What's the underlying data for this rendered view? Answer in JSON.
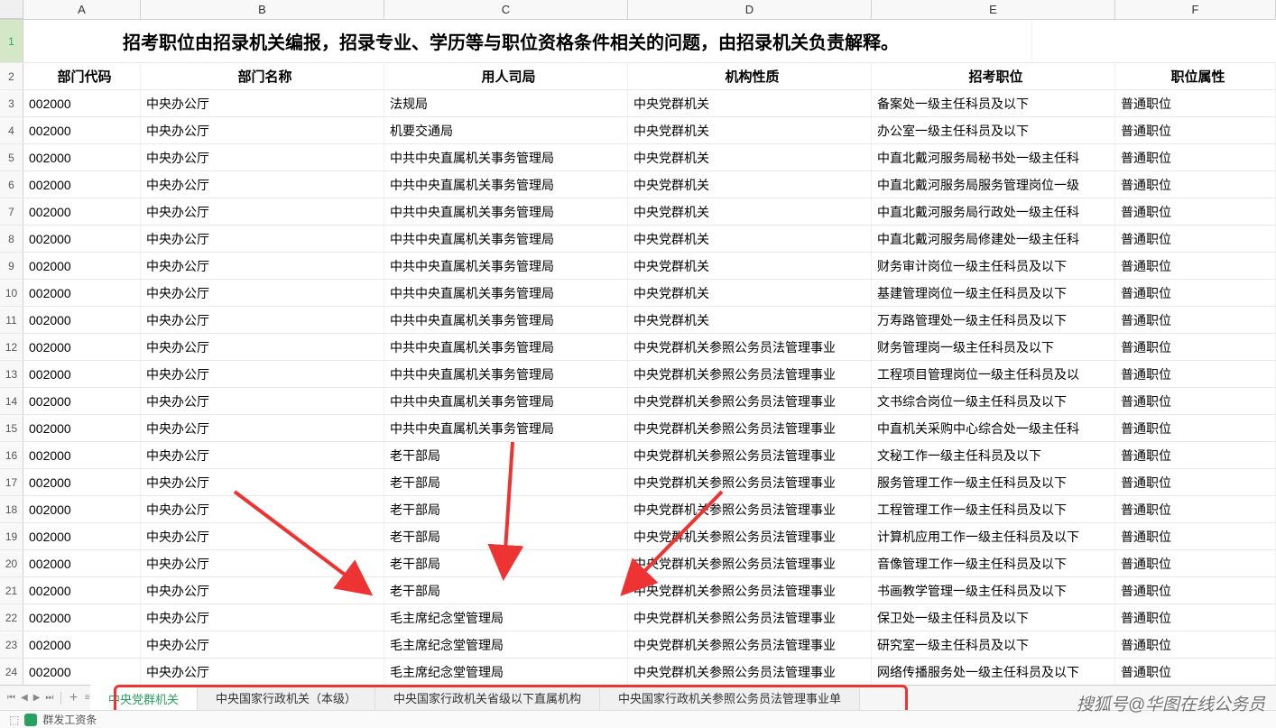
{
  "columns": [
    "A",
    "B",
    "C",
    "D",
    "E",
    "F"
  ],
  "title": "招考职位由招录机关编报，招录专业、学历等与职位资格条件相关的问题，由招录机关负责解释。",
  "headers": {
    "A": "部门代码",
    "B": "部门名称",
    "C": "用人司局",
    "D": "机构性质",
    "E": "招考职位",
    "F": "职位属性"
  },
  "rows": [
    {
      "n": 3,
      "A": "002000",
      "B": "中央办公厅",
      "C": "法规局",
      "D": "中央党群机关",
      "E": "备案处一级主任科员及以下",
      "F": "普通职位"
    },
    {
      "n": 4,
      "A": "002000",
      "B": "中央办公厅",
      "C": "机要交通局",
      "D": "中央党群机关",
      "E": "办公室一级主任科员及以下",
      "F": "普通职位"
    },
    {
      "n": 5,
      "A": "002000",
      "B": "中央办公厅",
      "C": "中共中央直属机关事务管理局",
      "D": "中央党群机关",
      "E": "中直北戴河服务局秘书处一级主任科",
      "F": "普通职位"
    },
    {
      "n": 6,
      "A": "002000",
      "B": "中央办公厅",
      "C": "中共中央直属机关事务管理局",
      "D": "中央党群机关",
      "E": "中直北戴河服务局服务管理岗位一级",
      "F": "普通职位"
    },
    {
      "n": 7,
      "A": "002000",
      "B": "中央办公厅",
      "C": "中共中央直属机关事务管理局",
      "D": "中央党群机关",
      "E": "中直北戴河服务局行政处一级主任科",
      "F": "普通职位"
    },
    {
      "n": 8,
      "A": "002000",
      "B": "中央办公厅",
      "C": "中共中央直属机关事务管理局",
      "D": "中央党群机关",
      "E": "中直北戴河服务局修建处一级主任科",
      "F": "普通职位"
    },
    {
      "n": 9,
      "A": "002000",
      "B": "中央办公厅",
      "C": "中共中央直属机关事务管理局",
      "D": "中央党群机关",
      "E": "财务审计岗位一级主任科员及以下",
      "F": "普通职位"
    },
    {
      "n": 10,
      "A": "002000",
      "B": "中央办公厅",
      "C": "中共中央直属机关事务管理局",
      "D": "中央党群机关",
      "E": "基建管理岗位一级主任科员及以下",
      "F": "普通职位"
    },
    {
      "n": 11,
      "A": "002000",
      "B": "中央办公厅",
      "C": "中共中央直属机关事务管理局",
      "D": "中央党群机关",
      "E": "万寿路管理处一级主任科员及以下",
      "F": "普通职位"
    },
    {
      "n": 12,
      "A": "002000",
      "B": "中央办公厅",
      "C": "中共中央直属机关事务管理局",
      "D": "中央党群机关参照公务员法管理事业",
      "E": "财务管理岗一级主任科员及以下",
      "F": "普通职位"
    },
    {
      "n": 13,
      "A": "002000",
      "B": "中央办公厅",
      "C": "中共中央直属机关事务管理局",
      "D": "中央党群机关参照公务员法管理事业",
      "E": "工程项目管理岗位一级主任科员及以",
      "F": "普通职位"
    },
    {
      "n": 14,
      "A": "002000",
      "B": "中央办公厅",
      "C": "中共中央直属机关事务管理局",
      "D": "中央党群机关参照公务员法管理事业",
      "E": "文书综合岗位一级主任科员及以下",
      "F": "普通职位"
    },
    {
      "n": 15,
      "A": "002000",
      "B": "中央办公厅",
      "C": "中共中央直属机关事务管理局",
      "D": "中央党群机关参照公务员法管理事业",
      "E": "中直机关采购中心综合处一级主任科",
      "F": "普通职位"
    },
    {
      "n": 16,
      "A": "002000",
      "B": "中央办公厅",
      "C": "老干部局",
      "D": "中央党群机关参照公务员法管理事业",
      "E": "文秘工作一级主任科员及以下",
      "F": "普通职位"
    },
    {
      "n": 17,
      "A": "002000",
      "B": "中央办公厅",
      "C": "老干部局",
      "D": "中央党群机关参照公务员法管理事业",
      "E": "服务管理工作一级主任科员及以下",
      "F": "普通职位"
    },
    {
      "n": 18,
      "A": "002000",
      "B": "中央办公厅",
      "C": "老干部局",
      "D": "中央党群机关参照公务员法管理事业",
      "E": "工程管理工作一级主任科员及以下",
      "F": "普通职位"
    },
    {
      "n": 19,
      "A": "002000",
      "B": "中央办公厅",
      "C": "老干部局",
      "D": "中央党群机关参照公务员法管理事业",
      "E": "计算机应用工作一级主任科员及以下",
      "F": "普通职位"
    },
    {
      "n": 20,
      "A": "002000",
      "B": "中央办公厅",
      "C": "老干部局",
      "D": "中央党群机关参照公务员法管理事业",
      "E": "音像管理工作一级主任科员及以下",
      "F": "普通职位"
    },
    {
      "n": 21,
      "A": "002000",
      "B": "中央办公厅",
      "C": "老干部局",
      "D": "中央党群机关参照公务员法管理事业",
      "E": "书画教学管理一级主任科员及以下",
      "F": "普通职位"
    },
    {
      "n": 22,
      "A": "002000",
      "B": "中央办公厅",
      "C": "毛主席纪念堂管理局",
      "D": "中央党群机关参照公务员法管理事业",
      "E": "保卫处一级主任科员及以下",
      "F": "普通职位"
    },
    {
      "n": 23,
      "A": "002000",
      "B": "中央办公厅",
      "C": "毛主席纪念堂管理局",
      "D": "中央党群机关参照公务员法管理事业",
      "E": "研究室一级主任科员及以下",
      "F": "普通职位"
    },
    {
      "n": 24,
      "A": "002000",
      "B": "中央办公厅",
      "C": "毛主席纪念堂管理局",
      "D": "中央党群机关参照公务员法管理事业",
      "E": "网络传播服务处一级主任科员及以下",
      "F": "普通职位"
    }
  ],
  "tabs": [
    {
      "label": "中央党群机关",
      "active": true
    },
    {
      "label": "中央国家行政机关（本级）",
      "active": false
    },
    {
      "label": "中央国家行政机关省级以下直属机构",
      "active": false
    },
    {
      "label": "中央国家行政机关参照公务员法管理事业单",
      "active": false
    }
  ],
  "statusbar": {
    "text": "群发工资条"
  },
  "watermark": "搜狐号@华图在线公务员"
}
